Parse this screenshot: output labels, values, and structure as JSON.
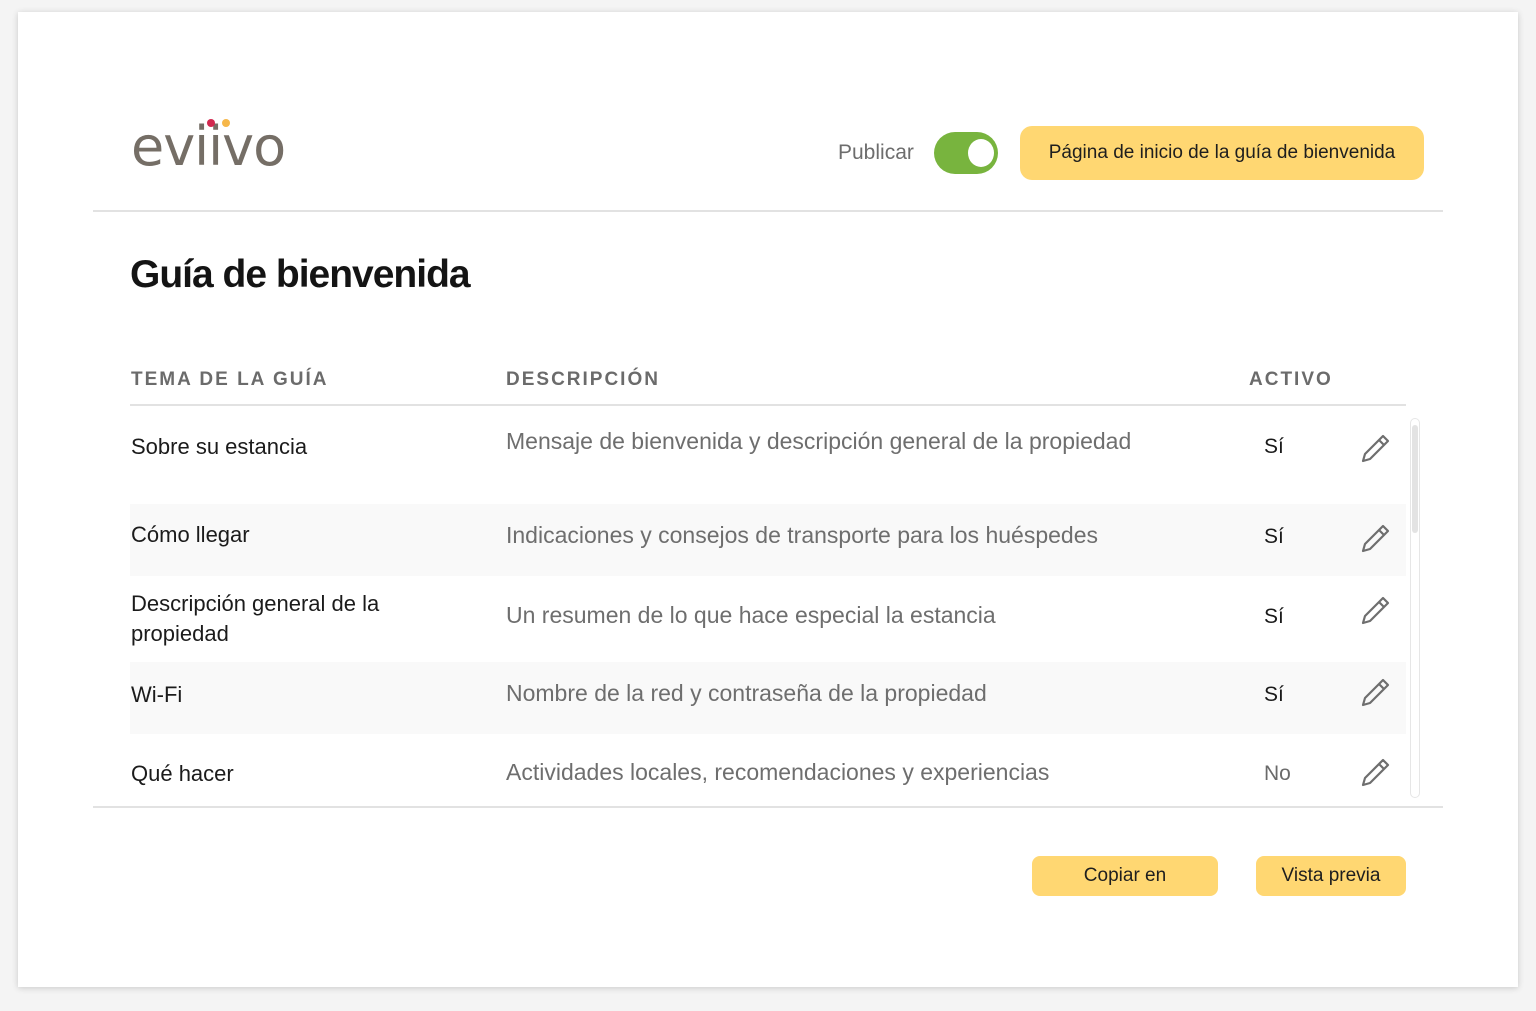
{
  "header": {
    "logo_text": "eviivo",
    "publish_label": "Publicar",
    "publish_on": true,
    "home_button_label": "Página de inicio de la guía de bienvenida"
  },
  "page": {
    "title": "Guía de bienvenida"
  },
  "table": {
    "columns": {
      "topic": "TEMA DE LA GUÍA",
      "description": "DESCRIPCIÓN",
      "active": "ACTIVO"
    },
    "rows": [
      {
        "topic": "Sobre su estancia",
        "description": "Mensaje de bienvenida y descripción general de la propiedad",
        "active": "Sí"
      },
      {
        "topic": "Cómo llegar",
        "description": "Indicaciones y consejos de transporte para los huéspedes",
        "active": "Sí"
      },
      {
        "topic": "Descripción general de la propiedad",
        "description": "Un resumen de lo que hace especial la estancia",
        "active": "Sí"
      },
      {
        "topic": "Wi-Fi",
        "description": "Nombre de la red y contraseña de la propiedad",
        "active": "Sí"
      },
      {
        "topic": "Qué hacer",
        "description": "Actividades locales, recomendaciones y experiencias",
        "active": "No"
      }
    ]
  },
  "footer": {
    "copy_label": "Copiar en",
    "preview_label": "Vista previa"
  },
  "colors": {
    "accent_yellow": "#ffd772",
    "toggle_green": "#78b43e",
    "logo_gray": "#756e66",
    "logo_dot_red": "#d2294f",
    "logo_dot_yellow": "#f6b74a"
  },
  "icons": {
    "edit": "pencil-icon"
  }
}
